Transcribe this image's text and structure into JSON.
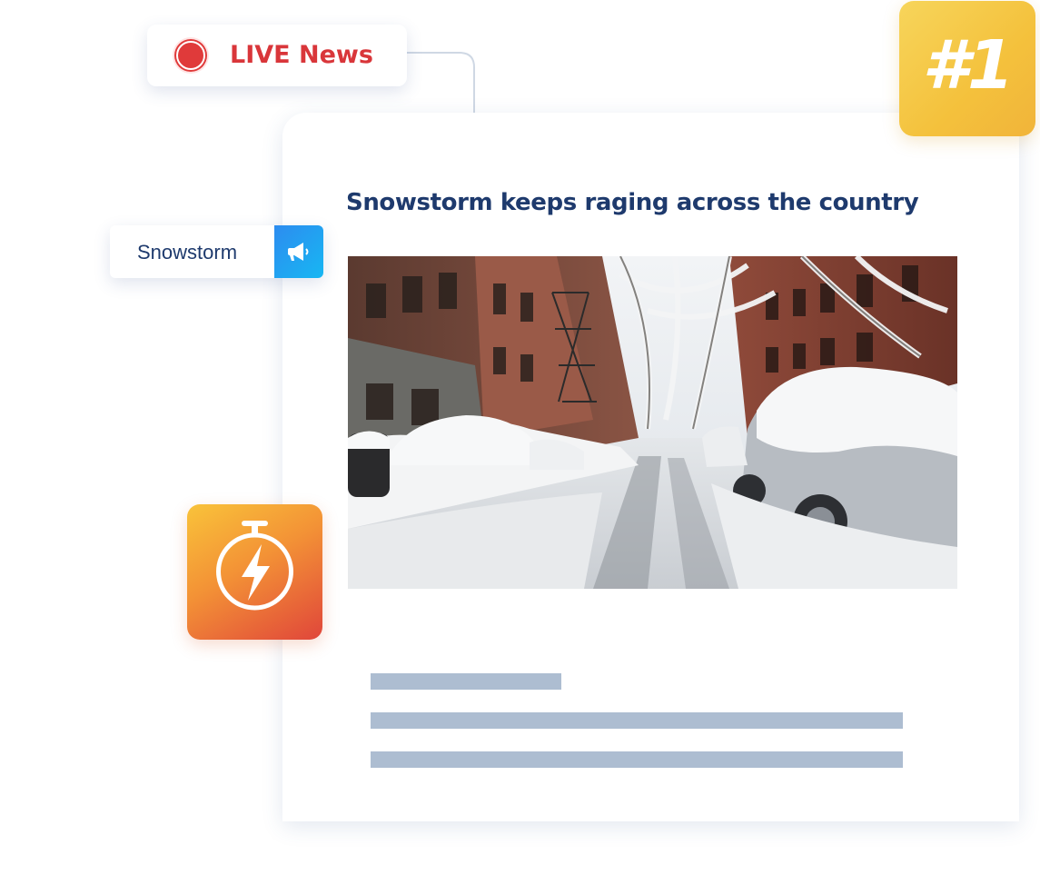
{
  "live_badge": {
    "label": "LIVE News",
    "dot_color": "#e03a3a",
    "icon": "record-dot-icon"
  },
  "rank_badge": {
    "label": "#1"
  },
  "topic_tag": {
    "label": "Snowstorm",
    "icon": "megaphone-icon",
    "icon_bg": "#2d8cf0"
  },
  "timer_tile": {
    "icon": "stopwatch-bolt-icon"
  },
  "article": {
    "headline": "Snowstorm keeps raging across the country",
    "image": "snowy-street-photo",
    "text_placeholder": "skeleton-lines"
  },
  "colors": {
    "headline": "#1e3a6d",
    "live_text": "#d9363a",
    "rank_gradient": [
      "#f7d55b",
      "#f1b43a"
    ],
    "timer_gradient": [
      "#f9c33a",
      "#e0463a"
    ],
    "skeleton": "#adbdd1"
  }
}
